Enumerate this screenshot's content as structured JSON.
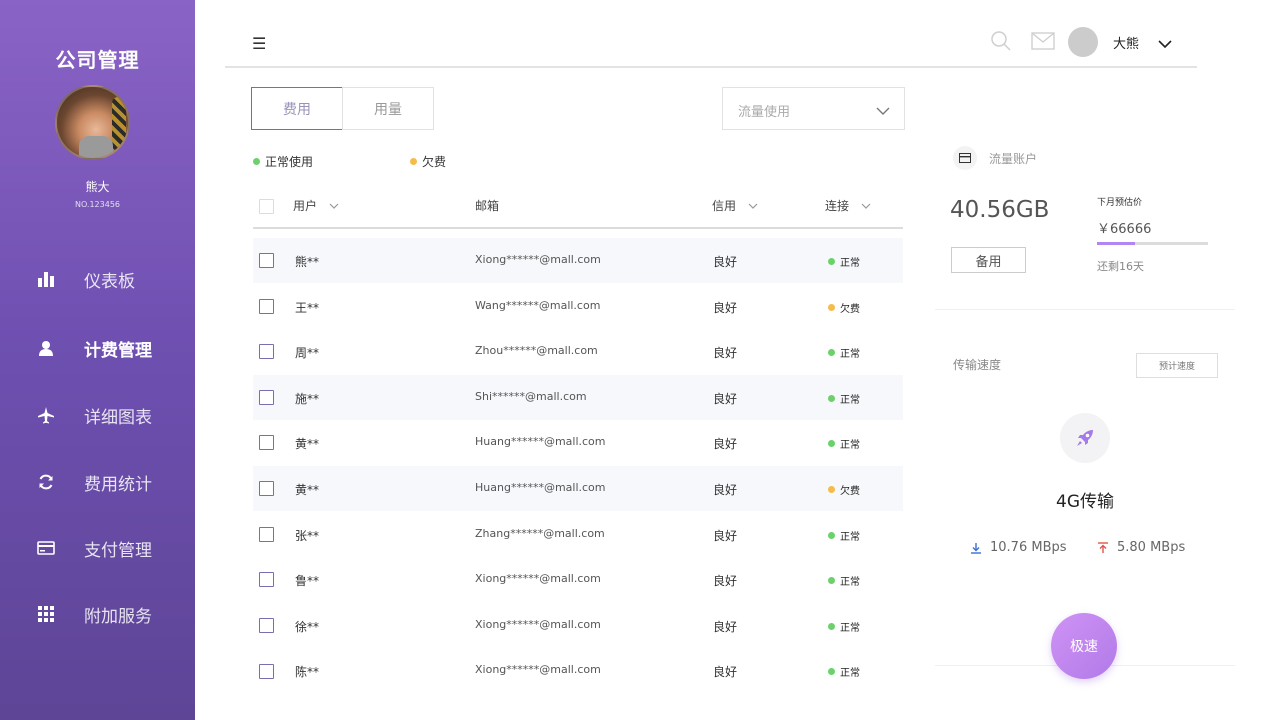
{
  "sidebar": {
    "brand": "公司管理",
    "user_name": "熊大",
    "user_no": "NO.123456",
    "items": [
      {
        "label": "仪表板",
        "icon": "bar-chart-icon"
      },
      {
        "label": "计费管理",
        "icon": "user-icon",
        "active": true
      },
      {
        "label": "详细图表",
        "icon": "airplane-icon"
      },
      {
        "label": "费用统计",
        "icon": "refresh-icon"
      },
      {
        "label": "支付管理",
        "icon": "card-icon"
      },
      {
        "label": "附加服务",
        "icon": "grid-icon"
      }
    ]
  },
  "topbar": {
    "menu_glyph": "☰",
    "user_name": "大熊"
  },
  "tabs": [
    {
      "label": "费用",
      "active": true
    },
    {
      "label": "用量",
      "active": false
    }
  ],
  "filter": {
    "selected": "流量使用"
  },
  "legend": {
    "normal": "正常使用",
    "overdue": "欠费"
  },
  "table": {
    "headers": {
      "user": "用户",
      "email": "邮箱",
      "credit": "信用",
      "connection": "连接"
    },
    "rows": [
      {
        "user": "熊**",
        "email": "Xiong******@mall.com",
        "credit": "良好",
        "status": "正常",
        "color": "#6bd26b"
      },
      {
        "user": "王**",
        "email": "Wang******@mall.com",
        "credit": "良好",
        "status": "欠费",
        "color": "#f5bb4b"
      },
      {
        "user": "周**",
        "email": "Zhou******@mall.com",
        "credit": "良好",
        "status": "正常",
        "color": "#6bd26b"
      },
      {
        "user": "施**",
        "email": "Shi******@mall.com",
        "credit": "良好",
        "status": "正常",
        "color": "#6bd26b"
      },
      {
        "user": "黄**",
        "email": "Huang******@mall.com",
        "credit": "良好",
        "status": "正常",
        "color": "#6bd26b"
      },
      {
        "user": "黄**",
        "email": "Huang******@mall.com",
        "credit": "良好",
        "status": "欠费",
        "color": "#f5bb4b"
      },
      {
        "user": "张**",
        "email": "Zhang******@mall.com",
        "credit": "良好",
        "status": "正常",
        "color": "#6bd26b"
      },
      {
        "user": "鲁**",
        "email": "Xiong******@mall.com",
        "credit": "良好",
        "status": "正常",
        "color": "#6bd26b"
      },
      {
        "user": "徐**",
        "email": "Xiong******@mall.com",
        "credit": "良好",
        "status": "正常",
        "color": "#6bd26b"
      },
      {
        "user": "陈**",
        "email": "Xiong******@mall.com",
        "credit": "良好",
        "status": "正常",
        "color": "#6bd26b"
      }
    ]
  },
  "account": {
    "title": "流量账户",
    "balance": "40.56GB",
    "spare_button": "备用",
    "next_label": "下月预估价",
    "next_price": "￥66666",
    "progress": 0.34,
    "remaining": "还剩16天"
  },
  "transfer": {
    "title": "传输速度",
    "estimate_button": "预计速度",
    "network": "4G传输",
    "download": "10.76 MBps",
    "upload": "5.80 MBps",
    "fast_button": "极速"
  },
  "colors": {
    "accent": "#7d68b8",
    "normal": "#6bd26b",
    "overdue": "#f5bb4b",
    "fast_button": "#b17ae8"
  }
}
